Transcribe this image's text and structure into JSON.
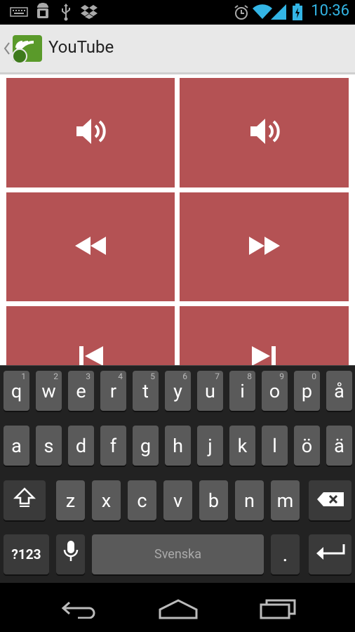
{
  "status_bar": {
    "time": "10:36",
    "icons": [
      "keyboard-icon",
      "android-debug-icon",
      "usb-icon",
      "dropbox-icon",
      "alarm-icon",
      "wifi-icon",
      "signal-icon",
      "battery-charging-icon"
    ]
  },
  "action_bar": {
    "title": "YouTube",
    "back_icon": "back-chevron-icon",
    "app_icon": "remote-app-icon"
  },
  "tiles": [
    {
      "name": "volume-down",
      "icon": "volume-low-icon"
    },
    {
      "name": "volume-up",
      "icon": "volume-high-icon"
    },
    {
      "name": "rewind",
      "icon": "rewind-icon"
    },
    {
      "name": "fast-forward",
      "icon": "fast-forward-icon"
    },
    {
      "name": "skip-previous",
      "icon": "skip-previous-icon"
    },
    {
      "name": "skip-next",
      "icon": "skip-next-icon"
    }
  ],
  "keyboard": {
    "row1": [
      "q",
      "w",
      "e",
      "r",
      "t",
      "y",
      "u",
      "i",
      "o",
      "p",
      "å"
    ],
    "row1_hints": [
      "1",
      "2",
      "3",
      "4",
      "5",
      "6",
      "7",
      "8",
      "9",
      "0",
      ""
    ],
    "row2": [
      "a",
      "s",
      "d",
      "f",
      "g",
      "h",
      "j",
      "k",
      "l",
      "ö",
      "ä"
    ],
    "row3": [
      "z",
      "x",
      "c",
      "v",
      "b",
      "n",
      "m"
    ],
    "symbols_label": "?123",
    "space_label": "Svenska",
    "period_label": "."
  },
  "nav_bar": {
    "icons": [
      "back-icon",
      "home-icon",
      "recent-apps-icon"
    ]
  },
  "colors": {
    "tile": "#b45254",
    "status_accent": "#33b5e5",
    "action_bar": "#e8e8e8",
    "keyboard_bg": "#222222",
    "key": "#5a5a5a"
  }
}
